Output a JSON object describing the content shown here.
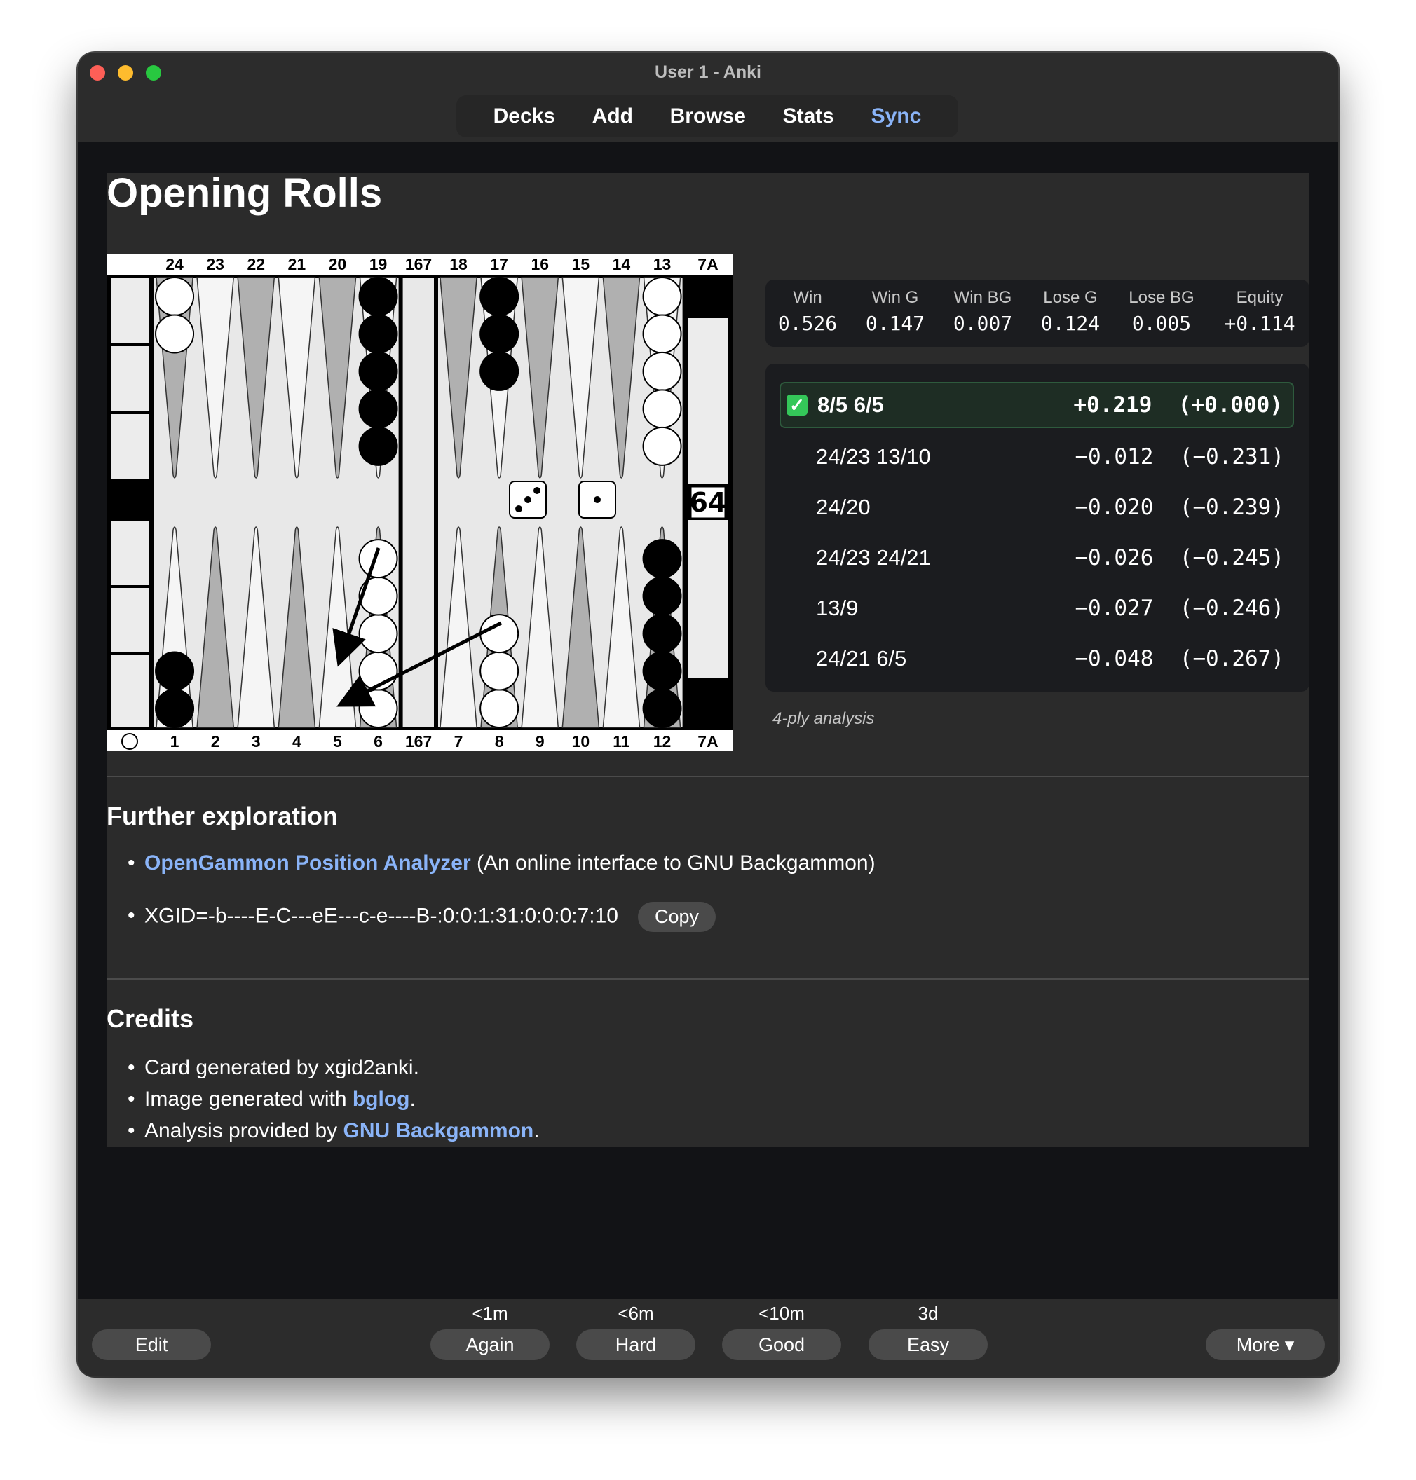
{
  "window": {
    "title": "User 1 - Anki"
  },
  "toolbar": {
    "decks": "Decks",
    "add": "Add",
    "browse": "Browse",
    "stats": "Stats",
    "sync": "Sync"
  },
  "card": {
    "title": "Opening Rolls",
    "board": {
      "top_labels": [
        "24",
        "23",
        "22",
        "21",
        "20",
        "19",
        "167",
        "18",
        "17",
        "16",
        "15",
        "14",
        "13",
        "7A"
      ],
      "bottom_labels": [
        "1",
        "2",
        "3",
        "4",
        "5",
        "6",
        "167",
        "7",
        "8",
        "9",
        "10",
        "11",
        "12",
        "7A"
      ],
      "cube_value": "64",
      "dice": [
        3,
        1
      ],
      "colors": {
        "dark_point": "#b0b0b0",
        "light_point": "#f5f5f5",
        "board_bg": "#ebebeb",
        "frame": "#000000"
      }
    },
    "stats": [
      {
        "label": "Win",
        "value": "0.526"
      },
      {
        "label": "Win G",
        "value": "0.147"
      },
      {
        "label": "Win BG",
        "value": "0.007"
      },
      {
        "label": "Lose G",
        "value": "0.124"
      },
      {
        "label": "Lose BG",
        "value": "0.005"
      },
      {
        "label": "Equity",
        "value": "+0.114"
      }
    ],
    "moves": [
      {
        "move": "8/5 6/5",
        "equity": "+0.219",
        "diff": "(+0.000)",
        "best": true
      },
      {
        "move": "24/23 13/10",
        "equity": "−0.012",
        "diff": "(−0.231)"
      },
      {
        "move": "24/20",
        "equity": "−0.020",
        "diff": "(−0.239)"
      },
      {
        "move": "24/23 24/21",
        "equity": "−0.026",
        "diff": "(−0.245)"
      },
      {
        "move": "13/9",
        "equity": "−0.027",
        "diff": "(−0.246)"
      },
      {
        "move": "24/21 6/5",
        "equity": "−0.048",
        "diff": "(−0.267)"
      }
    ],
    "analysis_note": "4-ply analysis",
    "further": {
      "heading": "Further exploration",
      "link_text": "OpenGammon Position Analyzer",
      "link_desc": " (An online interface to GNU Backgammon)",
      "xgid": "XGID=-b----E-C---eE---c-e----B-:0:0:1:31:0:0:0:7:10",
      "copy_label": "Copy"
    },
    "credits": {
      "heading": "Credits",
      "line1": "Card generated by xgid2anki.",
      "line2_pre": "Image generated with ",
      "line2_link": "bglog",
      "line2_post": ".",
      "line3_pre": "Analysis provided by ",
      "line3_link": "GNU Backgammon",
      "line3_post": "."
    }
  },
  "bottom": {
    "edit": "Edit",
    "again": "Again",
    "again_time": "<1m",
    "hard": "Hard",
    "hard_time": "<6m",
    "good": "Good",
    "good_time": "<10m",
    "easy": "Easy",
    "easy_time": "3d",
    "more": "More ▾"
  }
}
